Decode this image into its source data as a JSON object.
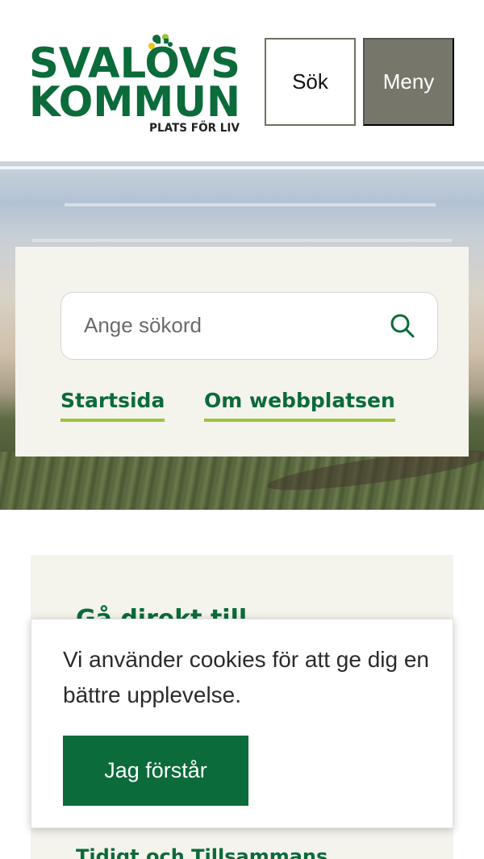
{
  "header": {
    "logo": {
      "line1": "SVALÖVS",
      "line2": "KOMMUN",
      "tagline": "PLATS FÖR LIV"
    },
    "search_button_label": "Sök",
    "menu_button_label": "Meny"
  },
  "hero": {
    "search": {
      "placeholder": "Ange sökord",
      "value": ""
    },
    "links": [
      {
        "label": "Startsida"
      },
      {
        "label": "Om webbplatsen"
      }
    ]
  },
  "direct": {
    "title": "Gå direkt till",
    "partial_link": "Tidigt och Tillsammans"
  },
  "cookie_banner": {
    "text": "Vi använder cookies för att ge dig en bättre upplevelse.",
    "accept_label": "Jag förstår"
  },
  "colors": {
    "brand_green": "#0b6b3a",
    "accent_green": "#9bc53d",
    "menu_gray": "#76776a",
    "panel_beige": "#f4f3ec"
  },
  "icons": {
    "search": "search-icon",
    "logo_mark": "flower-mark-icon"
  }
}
